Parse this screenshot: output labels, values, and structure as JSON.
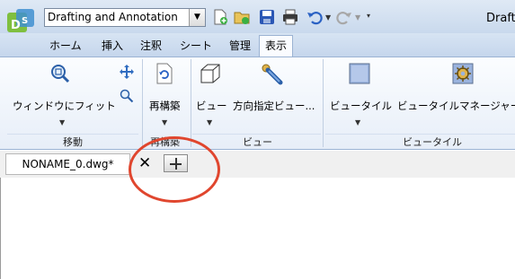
{
  "titlebar": {
    "workspace": "Drafting and Annotation",
    "window_title": "Draft"
  },
  "tabs": [
    {
      "label": "ホーム"
    },
    {
      "label": "挿入"
    },
    {
      "label": "注釈"
    },
    {
      "label": "シート"
    },
    {
      "label": "管理"
    },
    {
      "label": "表示",
      "active": true
    }
  ],
  "ribbon": {
    "groups": {
      "navigate": "移動",
      "rebuild": "再構築",
      "view": "ビュー",
      "viewtile": "ビュータイル"
    },
    "commands": {
      "fit_window": "ウィンドウにフィット",
      "rebuild": "再構築",
      "view": "ビュー",
      "directional_view": "方向指定ビュー...",
      "viewtile": "ビュータイル",
      "viewtile_manager": "ビュータイルマネージャー"
    }
  },
  "document_tabs": [
    {
      "label": "NONAME_0.dwg*"
    }
  ],
  "colors": {
    "annotation_circle": "#e0462e",
    "ribbon_accent": "#9bb3d3"
  }
}
